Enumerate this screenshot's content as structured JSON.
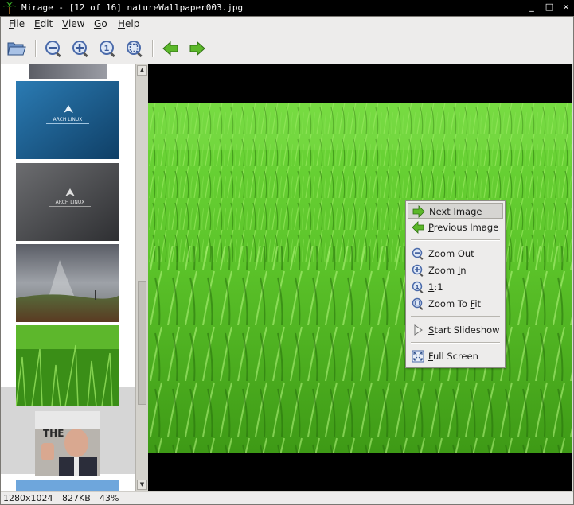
{
  "window": {
    "title": "Mirage - [12 of 16] natureWallpaper003.jpg",
    "buttons": [
      "_",
      "□",
      "×"
    ]
  },
  "menubar": {
    "items": [
      {
        "label": "File",
        "mnemonic": "F",
        "rest": "ile"
      },
      {
        "label": "Edit",
        "mnemonic": "E",
        "rest": "dit"
      },
      {
        "label": "View",
        "mnemonic": "V",
        "rest": "iew"
      },
      {
        "label": "Go",
        "mnemonic": "G",
        "rest": "o"
      },
      {
        "label": "Help",
        "mnemonic": "H",
        "rest": "elp"
      }
    ]
  },
  "toolbar": {
    "buttons": [
      "open-folder-icon",
      "zoom-out-icon",
      "zoom-in-icon",
      "zoom-1-1-icon",
      "zoom-fit-icon",
      "previous-arrow-icon",
      "next-arrow-icon"
    ]
  },
  "thumbnails": {
    "items": [
      {
        "kind": "partial-grey"
      },
      {
        "kind": "arch-blue",
        "text": "ARCH LINUX"
      },
      {
        "kind": "arch-grey",
        "text": "ARCH LINUX"
      },
      {
        "kind": "sky-landscape"
      },
      {
        "kind": "grass",
        "selected": true
      },
      {
        "kind": "portrait"
      },
      {
        "kind": "partial-blue"
      }
    ]
  },
  "context_menu": {
    "items": [
      {
        "mnemonic": "N",
        "rest": "ext Image",
        "icon": "next-arrow-icon",
        "highlighted": true
      },
      {
        "mnemonic": "P",
        "rest": "revious Image",
        "icon": "previous-arrow-icon"
      },
      {
        "sep": true
      },
      {
        "pre": "Zoom ",
        "mnemonic": "O",
        "rest": "ut",
        "icon": "zoom-out-icon"
      },
      {
        "pre": "Zoom ",
        "mnemonic": "I",
        "rest": "n",
        "icon": "zoom-in-icon"
      },
      {
        "mnemonic": "1",
        "rest": ":1",
        "icon": "zoom-1-1-icon"
      },
      {
        "pre": "Zoom To ",
        "mnemonic": "F",
        "rest": "it",
        "icon": "zoom-fit-icon"
      },
      {
        "sep": true
      },
      {
        "mnemonic": "S",
        "rest": "tart Slideshow",
        "icon": "play-icon"
      },
      {
        "sep": true
      },
      {
        "mnemonic": "F",
        "rest": "ull Screen",
        "icon": "fullscreen-icon"
      }
    ]
  },
  "statusbar": {
    "resolution": "1280x1024",
    "filesize": "827KB",
    "zoom": "43%"
  },
  "colors": {
    "grass": "#5fd12c",
    "arrow_green": "#5cb82a",
    "lens_blue": "#5a7cc0"
  }
}
